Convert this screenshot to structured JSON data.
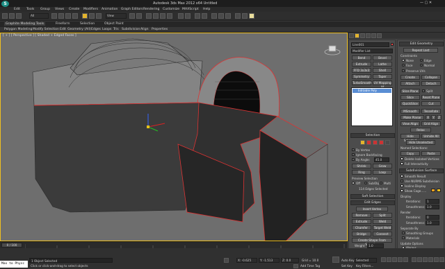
{
  "app": {
    "title": "Autodesk 3ds Max  2012 x64     Untitled"
  },
  "menu": [
    "Edit",
    "Tools",
    "Group",
    "Views",
    "Create",
    "Modifiers",
    "Animation",
    "Graph Editors",
    "Rendering",
    "Customize",
    "MAXScript",
    "Help"
  ],
  "toolbar": {
    "selection_filter": "All",
    "view_dropdown": "View"
  },
  "tabs": {
    "modeling": "Graphite Modeling Tools",
    "freeform": "Freeform",
    "selection": "Selection",
    "object_paint": "Object Paint"
  },
  "ribbon": [
    "Polygon Modeling",
    "Modify Selection",
    "Edit",
    "Geometry (All)",
    "Edges",
    "Loops",
    "Tris",
    "Subdivision",
    "Align",
    "Properties"
  ],
  "viewport": {
    "label": "[ + ] [ Perspective ] [ Shaded + Edged Faces ]",
    "accent": "#f0c020"
  },
  "command_panel": {
    "object_name": "Line001",
    "modifier_list": "Modifier List",
    "modifiers": [
      "Bend",
      "Bevel",
      "Extrude",
      "Lathe",
      "FFD 3x3x3",
      "Shell",
      "Symmetry",
      "Taper",
      "TurboSmooth",
      "XForm"
    ],
    "mod_labels": {
      "turbosmooth": "TurboSmooth",
      "uv": "UV Mapping Xf"
    },
    "stack_item": "Editable Poly",
    "selection_title": "Selection",
    "by_vertex": "By Vertex",
    "ignore_backfacing": "Ignore Backfacing",
    "by_angle": "By Angle:",
    "by_angle_value": "45.0",
    "shrink": "Shrink",
    "grow": "Grow",
    "ring": "Ring",
    "loop": "Loop",
    "preview_selection": "Preview Selection",
    "off": "Off",
    "subobj": "SubObj",
    "multi": "Multi",
    "edges_selected": "114 Edges Selected",
    "soft_selection": "Soft Selection",
    "edit_edges": "Edit Edges",
    "insert_vertex": "Insert Vertex",
    "remove": "Remove",
    "split": "Split",
    "extrude": "Extrude",
    "weld": "Weld",
    "chamfer": "Chamfer",
    "target_weld": "Target Weld",
    "bridge": "Bridge",
    "connect": "Connect",
    "create_shape": "Create Shape From Selection",
    "weight": "Weight",
    "weight_value": "1.0",
    "crease": "Crease",
    "crease_value": "0.0",
    "edit_geometry": "Edit Geometry",
    "repeat_last": "Repeat Last",
    "constraints": "Constraints",
    "none": "None",
    "edge": "Edge",
    "face": "Face",
    "normal": "Normal",
    "preserve_uvs": "Preserve UVs",
    "create": "Create",
    "collapse": "Collapse",
    "attach": "Attach",
    "detach": "Detach",
    "slice_plane": "Slice Plane",
    "split2": "Split",
    "slice": "Slice",
    "reset_plane": "Reset Plane",
    "quickslice": "QuickSlice",
    "cut": "Cut",
    "msmooth": "MSmooth",
    "tessellate": "Tessellate",
    "make_planar": "Make Planar",
    "x": "X",
    "y": "Y",
    "z": "Z",
    "view_align": "View Align",
    "grid_align": "Grid Align",
    "relax": "Relax",
    "hide_selected": "Hide Selected",
    "unhide_all": "Unhide All",
    "hide_unselected": "Hide Unselected",
    "named_selections": "Named Selections:",
    "copy": "Copy",
    "paste": "Paste",
    "delete_isolated": "Delete Isolated Vertices",
    "full_interactivity": "Full Interactivity",
    "subdivision_surface": "Subdivision Surface",
    "smooth_result": "Smooth Result",
    "use_nurms": "Use NURMS Subdivision",
    "isoline": "Isoline Display",
    "show_cage": "Show Cage......",
    "display": "Display",
    "iterations": "Iterations:",
    "iterations_value": "1",
    "smoothness": "Smoothness:",
    "smoothness_value": "1.0",
    "render": "Render",
    "render_iterations": "Iterations:",
    "render_iterations_value": "0",
    "render_smoothness": "Smoothness:",
    "render_smoothness_value": "1.0",
    "separate_by": "Separate By",
    "smoothing_groups": "Smoothing Groups",
    "materials": "Materials",
    "update_options": "Update Options",
    "always": "Always",
    "when_rendering": "When Rendering",
    "manually": "Manually"
  },
  "timeline": {
    "frame": "0 / 100"
  },
  "status": {
    "script": "Max to Physc",
    "objects_selected": "1 Object Selected",
    "hint": "Click or click-and-drag to select objects",
    "x": "X: -0.625",
    "y": "Y: -1.513",
    "z": "Z: 0.0",
    "grid": "Grid = 10.0",
    "auto_key": "Auto Key",
    "selected": "Selected",
    "set_key": "Set Key",
    "key_filters": "Key Filters...",
    "add_time_tag": "Add Time Tag"
  }
}
